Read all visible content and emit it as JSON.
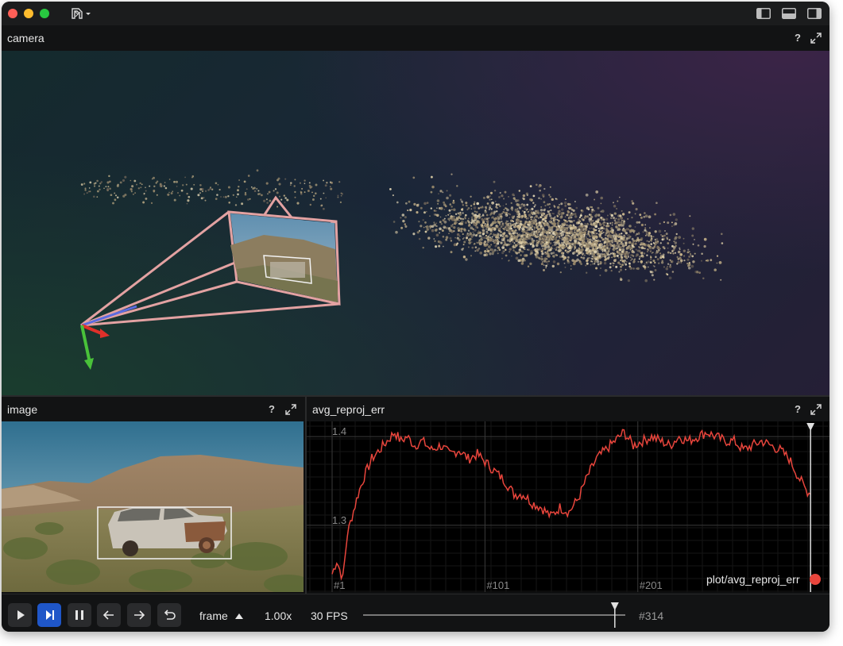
{
  "window": {
    "traffic_lights": [
      "#ff5f57",
      "#febc2e",
      "#28c840"
    ],
    "app_icon": "rerun-logo-icon",
    "layout_icons": [
      "left-panel-toggle-icon",
      "bottom-panel-toggle-icon",
      "right-panel-toggle-icon"
    ]
  },
  "panels": {
    "camera": {
      "title": "camera",
      "help": "?",
      "expand_icon": "expand-icon"
    },
    "image": {
      "title": "image",
      "help": "?",
      "expand_icon": "expand-icon"
    },
    "plot": {
      "title": "avg_reproj_err",
      "help": "?",
      "expand_icon": "expand-icon",
      "legend_label": "plot/avg_reproj_err",
      "legend_color": "#e8453c"
    }
  },
  "chart_data": {
    "type": "line",
    "title": "",
    "series": [
      {
        "name": "plot/avg_reproj_err",
        "color": "#e8453c",
        "x": [
          1,
          4,
          8,
          11,
          14,
          18,
          22,
          27,
          32,
          37,
          42,
          46,
          50,
          55,
          60,
          66,
          72,
          78,
          84,
          90,
          96,
          102,
          108,
          114,
          120,
          126,
          132,
          138,
          144,
          150,
          156,
          162,
          168,
          174,
          180,
          186,
          192,
          198,
          204,
          210,
          216,
          222,
          228,
          234,
          240,
          246,
          252,
          258,
          264,
          270,
          276,
          282,
          288,
          294,
          300,
          306,
          311,
          314
        ],
        "values": [
          1.245,
          1.26,
          1.24,
          1.29,
          1.31,
          1.335,
          1.355,
          1.375,
          1.385,
          1.395,
          1.405,
          1.395,
          1.4,
          1.39,
          1.395,
          1.385,
          1.39,
          1.38,
          1.385,
          1.375,
          1.38,
          1.37,
          1.36,
          1.35,
          1.335,
          1.335,
          1.325,
          1.32,
          1.31,
          1.32,
          1.315,
          1.33,
          1.355,
          1.375,
          1.385,
          1.395,
          1.405,
          1.39,
          1.395,
          1.4,
          1.395,
          1.39,
          1.4,
          1.395,
          1.4,
          1.405,
          1.4,
          1.395,
          1.395,
          1.385,
          1.39,
          1.395,
          1.39,
          1.385,
          1.375,
          1.355,
          1.34,
          1.335
        ]
      }
    ],
    "yticks": [
      "1.4",
      "1.3"
    ],
    "yvalues": [
      1.4,
      1.3
    ],
    "xticks": [
      "#1",
      "#101",
      "#201"
    ],
    "xvalues": [
      1,
      101,
      201
    ],
    "xlim": [
      1,
      316
    ],
    "ylim": [
      1.23,
      1.41
    ],
    "cursor": 314,
    "grid": true,
    "legend": "bottom-right"
  },
  "timeline": {
    "play_icon": "play-icon",
    "step_icon": "step-forward-icon",
    "pause_icon": "pause-icon",
    "prev_icon": "arrow-left-icon",
    "next_icon": "arrow-right-icon",
    "loop_icon": "loop-icon",
    "timeline_name": "frame",
    "speed": "1.00x",
    "fps": "30 FPS",
    "current_frame": "#314",
    "progress": 0.96
  }
}
